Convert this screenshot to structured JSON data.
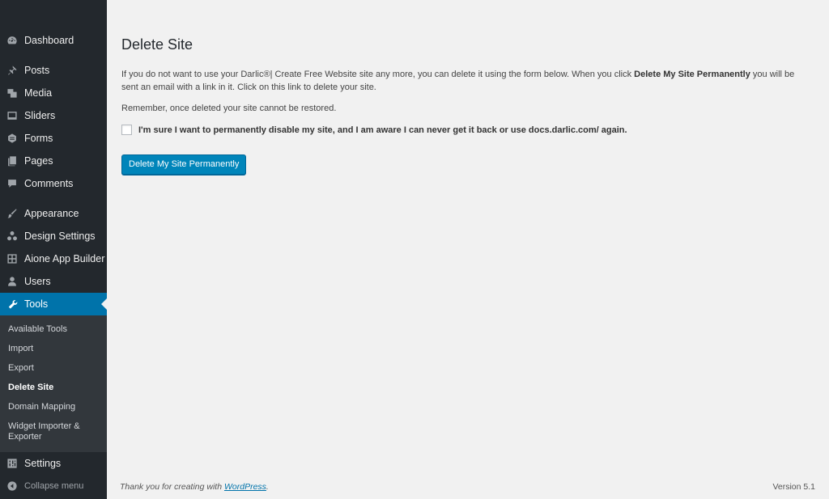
{
  "sidebar": {
    "items": [
      {
        "label": "Dashboard",
        "icon": "dashboard-icon"
      },
      {
        "label": "Posts",
        "icon": "pin-icon"
      },
      {
        "label": "Media",
        "icon": "media-icon"
      },
      {
        "label": "Sliders",
        "icon": "slides-icon"
      },
      {
        "label": "Forms",
        "icon": "forms-icon"
      },
      {
        "label": "Pages",
        "icon": "pages-icon"
      },
      {
        "label": "Comments",
        "icon": "comments-icon"
      },
      {
        "label": "Appearance",
        "icon": "brush-icon"
      },
      {
        "label": "Design Settings",
        "icon": "design-icon"
      },
      {
        "label": "Aione App Builder",
        "icon": "grid-icon"
      },
      {
        "label": "Users",
        "icon": "user-icon"
      },
      {
        "label": "Tools",
        "icon": "wrench-icon"
      },
      {
        "label": "Settings",
        "icon": "settings-icon"
      }
    ],
    "submenu": [
      "Available Tools",
      "Import",
      "Export",
      "Delete Site",
      "Domain Mapping",
      "Widget Importer & Exporter"
    ],
    "collapse_label": "Collapse menu"
  },
  "main": {
    "title": "Delete Site",
    "desc_pre": "If you do not want to use your Darlic®| Create Free Website site any more, you can delete it using the form below. When you click ",
    "desc_strong": "Delete My Site Permanently",
    "desc_post": " you will be sent an email with a link in it. Click on this link to delete your site.",
    "remember": "Remember, once deleted your site cannot be restored.",
    "confirm_label": "I'm sure I want to permanently disable my site, and I am aware I can never get it back or use docs.darlic.com/ again.",
    "delete_button": "Delete My Site Permanently"
  },
  "footer": {
    "thanks_pre": "Thank you for creating with ",
    "thanks_link": "WordPress",
    "thanks_post": ".",
    "version": "Version 5.1"
  },
  "colors": {
    "sidebar_bg": "#23282d",
    "submenu_bg": "#32373c",
    "accent": "#0073aa",
    "button": "#0085ba"
  }
}
